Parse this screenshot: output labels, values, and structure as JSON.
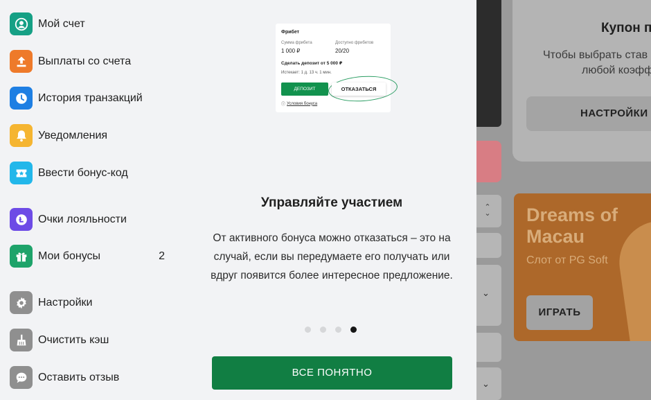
{
  "menu": {
    "items": [
      {
        "label": "Мой счет",
        "icon": "account-icon",
        "color": "#16a085"
      },
      {
        "label": "Выплаты со счета",
        "icon": "withdraw-icon",
        "color": "#ee7a2a"
      },
      {
        "label": "История транзакций",
        "icon": "clock-icon",
        "color": "#1e7fe3"
      },
      {
        "label": "Уведомления",
        "icon": "bell-icon",
        "color": "#f5b531"
      },
      {
        "label": "Ввести бонус-код",
        "icon": "ticket-icon",
        "color": "#22b7ea"
      },
      {
        "label": "Очки лояльности",
        "icon": "loyalty-icon",
        "color": "#6d4be6"
      },
      {
        "label": "Мои бонусы",
        "icon": "gift-icon",
        "color": "#1ea36a",
        "count": "2"
      },
      {
        "label": "Настройки",
        "icon": "gear-icon",
        "color": "#8f8f8f"
      },
      {
        "label": "Очистить кэш",
        "icon": "broom-icon",
        "color": "#8f8f8f"
      },
      {
        "label": "Оставить отзыв",
        "icon": "chat-icon",
        "color": "#8f8f8f"
      }
    ]
  },
  "onboarding": {
    "card": {
      "title": "Фрибет",
      "amount_label": "Сумма фрибета",
      "amount_value": "1 000 ₽",
      "available_label": "Доступно фрибетов",
      "available_value": "20/20",
      "deposit_text": "Сделать депозит от 5 000 ₽",
      "expires": "Истекает: 1 д. 13 ч. 1 мин.",
      "deposit_button": "ДЕПОЗИТ",
      "refuse_button": "ОТКАЗАТЬСЯ",
      "terms_link": "Условия бонуса",
      "highlight_color": "#2a9d62"
    },
    "title": "Управляйте участием",
    "text": "От активного бонуса можно отказаться – это на случай, если вы передумаете его получать или вдруг появится более интересное предложение.",
    "pages": 4,
    "active_page": 4,
    "button": "ВСЕ ПОНЯТНО",
    "accent": "#117e43"
  },
  "background": {
    "coupon_title": "Купон п",
    "coupon_text_line1": "Чтобы выбрать став",
    "coupon_text_line2": "любой коэфф",
    "coupon_button": "НАСТРОЙКИ",
    "promo_title": "Dreams of Macau",
    "promo_subtitle": "Слот от PG Soft",
    "promo_button": "ИГРАТЬ"
  }
}
